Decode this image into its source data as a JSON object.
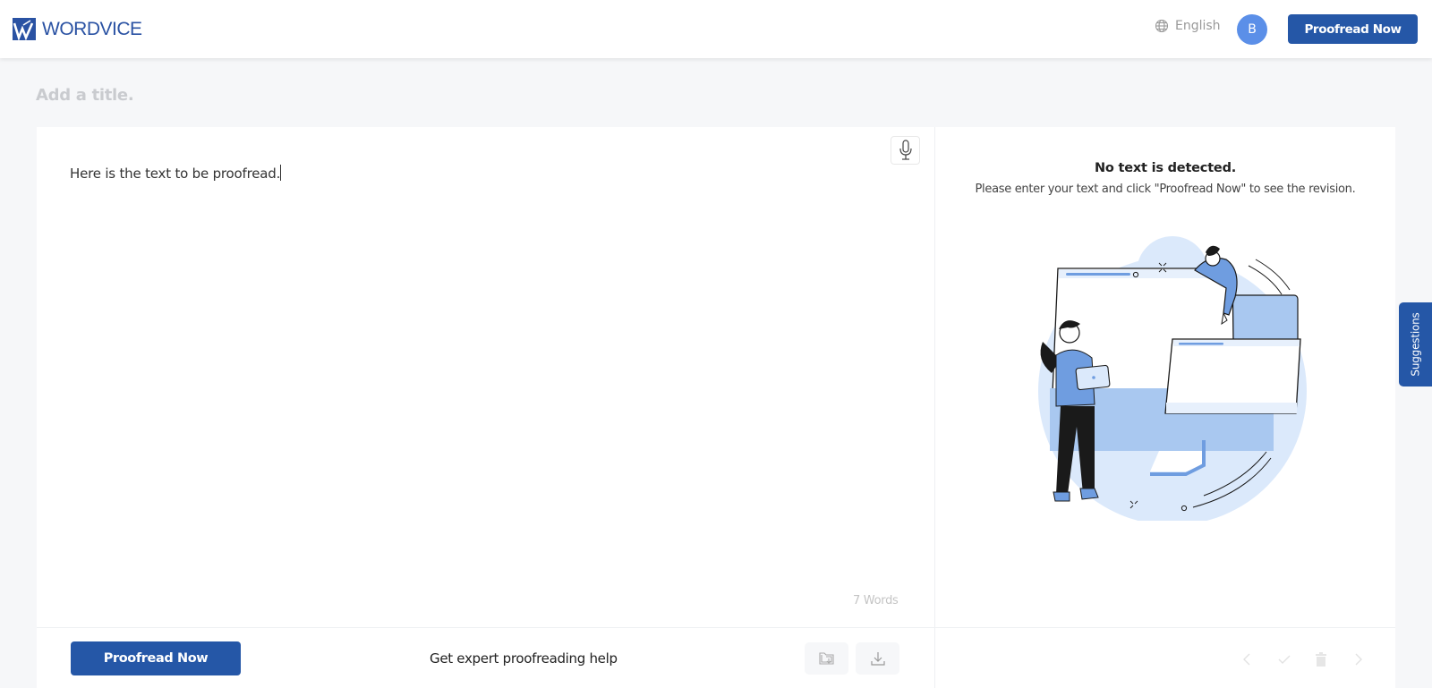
{
  "header": {
    "brand": "WORDVICE",
    "language": "English",
    "avatar_initial": "B",
    "cta_label": "Proofread Now"
  },
  "document": {
    "title_placeholder": "Add a title.",
    "text": "Here is the text to be proofread.",
    "word_count": "7 Words"
  },
  "editor_footer": {
    "proofread_label": "Proofread Now",
    "expert_help": "Get expert proofreading help"
  },
  "result": {
    "empty_title": "No text is detected.",
    "empty_message": "Please enter your text and click \"Proofread Now\" to see the revision."
  },
  "suggestions_tab": "Suggestions",
  "icons": {
    "language": "globe-icon",
    "mic": "microphone-icon",
    "folder": "folder-download-icon",
    "download": "download-icon",
    "prev": "chevron-left-icon",
    "accept": "check-icon",
    "delete": "trash-icon",
    "next": "chevron-right-icon"
  },
  "colors": {
    "brand": "#2557a7",
    "avatar": "#5b8fe8",
    "illustration_light": "#dbe9fb",
    "illustration_mid": "#a9c8f0",
    "illustration_accent": "#6f9de0"
  }
}
